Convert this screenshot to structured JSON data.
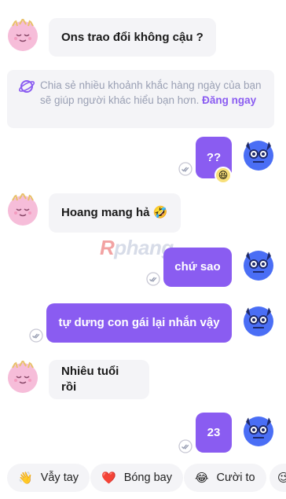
{
  "messages": [
    {
      "id": "m1",
      "text": "Ons trao đổi không cậu ?"
    },
    {
      "id": "m2",
      "text": "??",
      "reaction": "😆"
    },
    {
      "id": "m3",
      "text": "Hoang mang hả 🤣"
    },
    {
      "id": "m4",
      "text": "chứ sao"
    },
    {
      "id": "m5",
      "text": "tự dưng con gái lại nhắn vậy"
    },
    {
      "id": "m6",
      "text": "Nhiêu tuổi rồi"
    },
    {
      "id": "m7",
      "text": "23"
    }
  ],
  "notice": {
    "text": "Chia sẻ nhiều khoảnh khắc hàng ngày của bạn sẽ giúp người khác hiểu bạn hơn. ",
    "link": "Đăng ngay"
  },
  "watermark": {
    "first": "R",
    "rest": "phang"
  },
  "quick_replies": [
    {
      "emoji": "👋",
      "label": "Vẫy tay"
    },
    {
      "emoji": "❤️",
      "label": "Bóng bay"
    },
    {
      "emoji": "😂",
      "label": "Cười to"
    },
    {
      "emoji": "😉",
      "label": ""
    }
  ],
  "colors": {
    "accent": "#8a5cf1",
    "bubble_in": "#f4f4f7",
    "avatar_left": "#f5b9d7",
    "avatar_right": "#4a6ef5"
  }
}
